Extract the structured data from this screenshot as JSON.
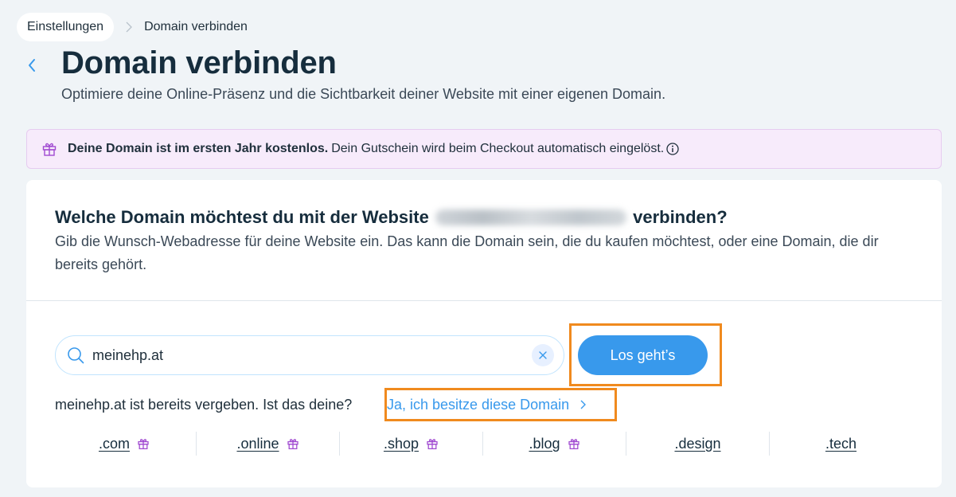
{
  "breadcrumb": {
    "parent": "Einstellungen",
    "current": "Domain verbinden"
  },
  "header": {
    "title": "Domain verbinden",
    "subtitle": "Optimiere deine Online-Präsenz und die Sichtbarkeit deiner Website mit einer eigenen Domain."
  },
  "banner": {
    "bold": "Deine Domain ist im ersten Jahr kostenlos.",
    "text": "Dein Gutschein wird beim Checkout automatisch eingelöst."
  },
  "card": {
    "question_before": "Welche Domain möchtest du mit der Website",
    "question_after": "verbinden?",
    "description": "Gib die Wunsch-Webadresse für deine Website ein. Das kann die Domain sein, die du kaufen möchtest, oder eine Domain, die dir bereits gehört.",
    "search_value": "meinehp.at",
    "go_button": "Los geht’s",
    "taken_text": "meinehp.at ist bereits vergeben. Ist das deine?",
    "own_link": "Ja, ich besitze diese Domain"
  },
  "tlds": [
    {
      "label": ".com",
      "gift": true
    },
    {
      "label": ".online",
      "gift": true
    },
    {
      "label": ".shop",
      "gift": true
    },
    {
      "label": ".blog",
      "gift": true
    },
    {
      "label": ".design",
      "gift": false
    },
    {
      "label": ".tech",
      "gift": false
    }
  ],
  "colors": {
    "accent": "#3899ec",
    "highlight": "#f08a1e",
    "banner_bg": "#f7ebfb",
    "gift": "#a14bd1"
  },
  "icons": {
    "back": "chevron-left-icon",
    "separator": "chevron-right-icon",
    "banner": "gift-icon",
    "info": "info-icon",
    "search": "search-icon",
    "clear": "close-icon",
    "link_arrow": "chevron-right-icon"
  }
}
